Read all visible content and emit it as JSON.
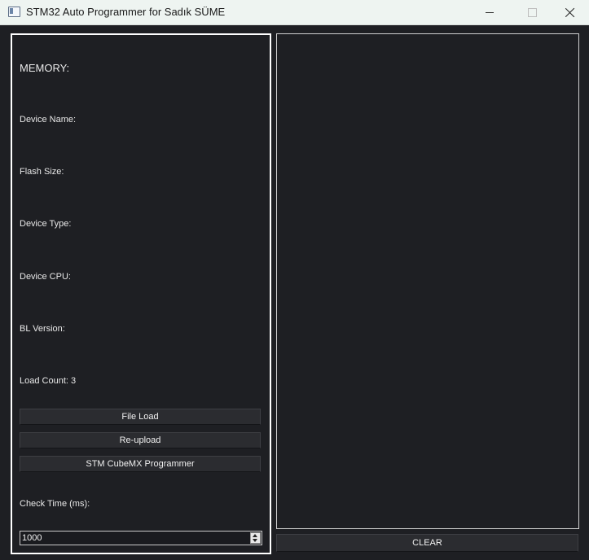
{
  "window": {
    "title": "STM32 Auto Programmer for Sadık SÜME",
    "icon": "app-window-icon"
  },
  "info": {
    "memory_label": "MEMORY:",
    "device_name_label": "Device Name:",
    "flash_size_label": "Flash Size:",
    "device_type_label": "Device Type:",
    "device_cpu_label": "Device CPU:",
    "bl_version_label": "BL Version:",
    "load_count_label": "Load Count: 3"
  },
  "buttons": {
    "file_load": "File Load",
    "reupload": "Re-upload",
    "cubemx": "STM CubeMX Programmer",
    "clear": "CLEAR"
  },
  "check_time": {
    "label": "Check Time (ms):",
    "value": "1000"
  },
  "colors": {
    "background": "#1e1f23",
    "titlebar": "#eef4f1",
    "panel_border": "#ffffff",
    "button": "#2b2c30"
  }
}
